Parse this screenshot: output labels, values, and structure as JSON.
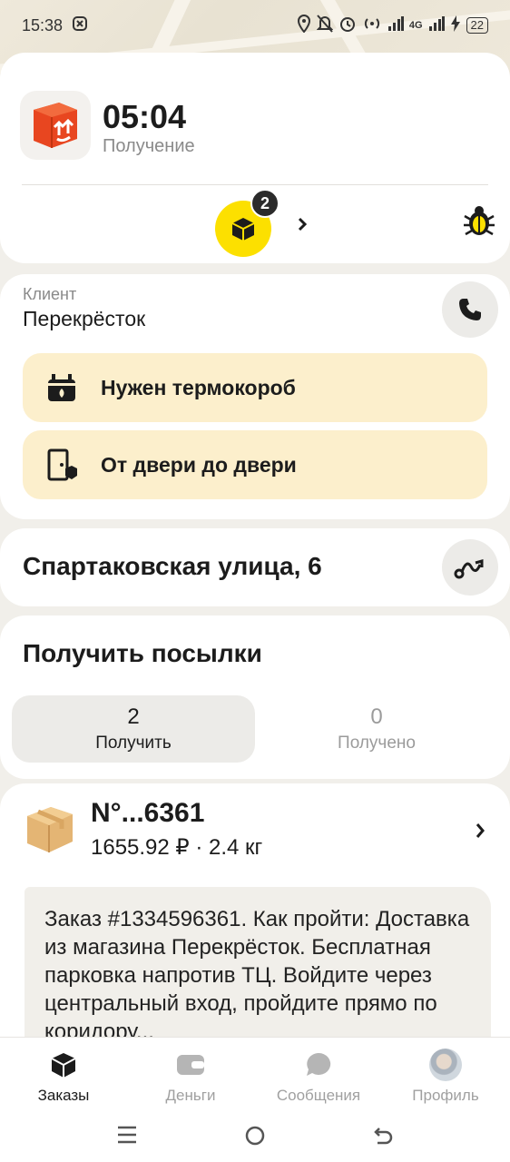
{
  "status_bar": {
    "time": "15:38",
    "network": "4G",
    "battery": "22"
  },
  "header": {
    "timer": "05:04",
    "phase": "Получение",
    "orders_count": "2"
  },
  "client": {
    "label": "Клиент",
    "name": "Перекрёсток",
    "tags": [
      "Нужен термокороб",
      "От двери до двери"
    ]
  },
  "address": {
    "text": "Спартаковская улица, 6"
  },
  "receive": {
    "title": "Получить посылки",
    "tabs": [
      {
        "count": "2",
        "label": "Получить"
      },
      {
        "count": "0",
        "label": "Получено"
      }
    ]
  },
  "parcel": {
    "number": "N°...6361",
    "meta": "1655.92 ₽ · 2.4 кг",
    "note": "Заказ #1334596361. Как пройти: Доставка из магазина Перекрёсток. Бесплатная парковка напротив ТЦ. Войдите через центральный вход, пройдите прямо по коридору..."
  },
  "bottom_nav": {
    "items": [
      {
        "label": "Заказы",
        "icon": "box-icon"
      },
      {
        "label": "Деньги",
        "icon": "wallet-icon"
      },
      {
        "label": "Сообщения",
        "icon": "chat-icon"
      },
      {
        "label": "Профиль",
        "icon": "avatar"
      }
    ]
  },
  "colors": {
    "accent_yellow": "#fce000",
    "tag_bg": "#fcefcc",
    "app_icon_red": "#e84620"
  }
}
